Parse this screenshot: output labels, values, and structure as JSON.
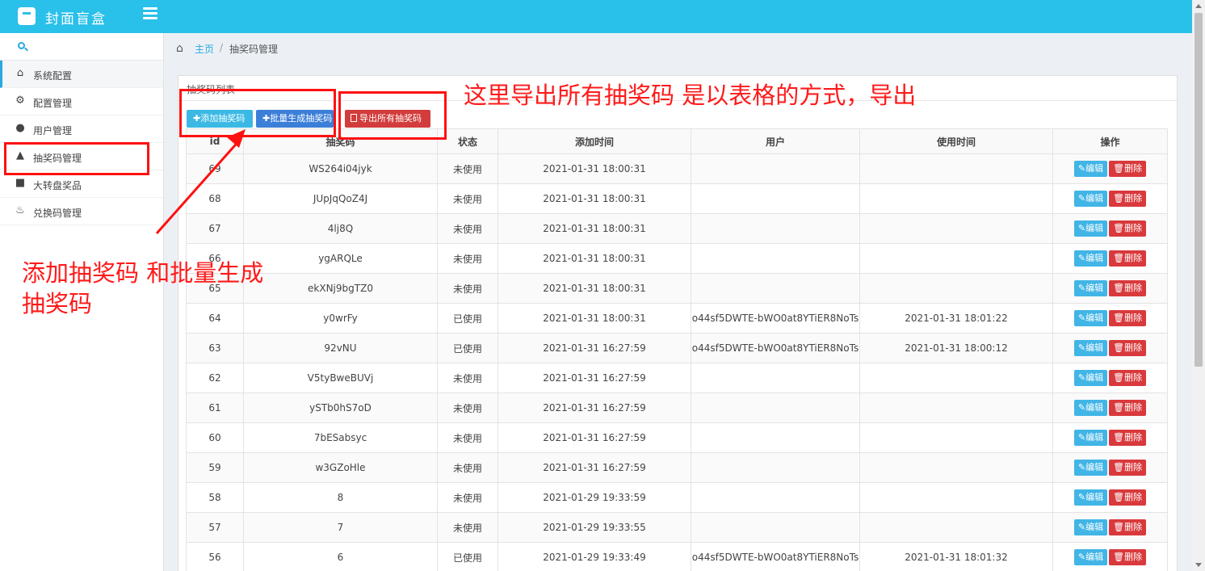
{
  "app": {
    "title": "封面盲盒"
  },
  "sidebar": {
    "items": [
      {
        "label": "系统配置",
        "icon": "home-icon"
      },
      {
        "label": "配置管理",
        "icon": "gear-icon"
      },
      {
        "label": "用户管理",
        "icon": "user-icon"
      },
      {
        "label": "抽奖码管理",
        "icon": "road-icon"
      },
      {
        "label": "大转盘奖品",
        "icon": "gift-icon"
      },
      {
        "label": "兑换码管理",
        "icon": "fire-icon"
      }
    ]
  },
  "breadcrumb": {
    "home": "主页",
    "separator": "/",
    "current": "抽奖码管理"
  },
  "panel": {
    "title": "抽奖码列表"
  },
  "toolbar": {
    "add_label": "✚添加抽奖码",
    "batch_label": "✚批量生成抽奖码",
    "export_label": "导出所有抽奖码"
  },
  "table": {
    "headers": [
      "id",
      "抽奖码",
      "状态",
      "添加时间",
      "用户",
      "使用时间",
      "操作"
    ],
    "edit_label": "编辑",
    "delete_label": "删除",
    "rows": [
      {
        "id": "69",
        "code": "WS264i04jyk",
        "status": "未使用",
        "added": "2021-01-31 18:00:31",
        "user": "",
        "used": ""
      },
      {
        "id": "68",
        "code": "JUpJqQoZ4J",
        "status": "未使用",
        "added": "2021-01-31 18:00:31",
        "user": "",
        "used": ""
      },
      {
        "id": "67",
        "code": "4lj8Q",
        "status": "未使用",
        "added": "2021-01-31 18:00:31",
        "user": "",
        "used": ""
      },
      {
        "id": "66",
        "code": "ygARQLe",
        "status": "未使用",
        "added": "2021-01-31 18:00:31",
        "user": "",
        "used": ""
      },
      {
        "id": "65",
        "code": "ekXNj9bgTZ0",
        "status": "未使用",
        "added": "2021-01-31 18:00:31",
        "user": "",
        "used": ""
      },
      {
        "id": "64",
        "code": "y0wrFy",
        "status": "已使用",
        "added": "2021-01-31 18:00:31",
        "user": "o44sf5DWTE-bWO0at8YTiER8NoTs",
        "used": "2021-01-31 18:01:22"
      },
      {
        "id": "63",
        "code": "92vNU",
        "status": "已使用",
        "added": "2021-01-31 16:27:59",
        "user": "o44sf5DWTE-bWO0at8YTiER8NoTs",
        "used": "2021-01-31 18:00:12"
      },
      {
        "id": "62",
        "code": "V5tyBweBUVj",
        "status": "未使用",
        "added": "2021-01-31 16:27:59",
        "user": "",
        "used": ""
      },
      {
        "id": "61",
        "code": "ySTb0hS7oD",
        "status": "未使用",
        "added": "2021-01-31 16:27:59",
        "user": "",
        "used": ""
      },
      {
        "id": "60",
        "code": "7bESabsyc",
        "status": "未使用",
        "added": "2021-01-31 16:27:59",
        "user": "",
        "used": ""
      },
      {
        "id": "59",
        "code": "w3GZoHle",
        "status": "未使用",
        "added": "2021-01-31 16:27:59",
        "user": "",
        "used": ""
      },
      {
        "id": "58",
        "code": "8",
        "status": "未使用",
        "added": "2021-01-29 19:33:59",
        "user": "",
        "used": ""
      },
      {
        "id": "57",
        "code": "7",
        "status": "未使用",
        "added": "2021-01-29 19:33:55",
        "user": "",
        "used": ""
      },
      {
        "id": "56",
        "code": "6",
        "status": "已使用",
        "added": "2021-01-29 19:33:49",
        "user": "o44sf5DWTE-bWO0at8YTiER8NoTs",
        "used": "2021-01-31 18:01:32"
      }
    ]
  },
  "annotations": {
    "export_note": "这里导出所有抽奖码 是以表格的方式，导出",
    "add_note_line1": "添加抽奖码 和批量生成",
    "add_note_line2": "抽奖码"
  },
  "colors": {
    "topbar": "#29c0e9",
    "accent": "#29a9e0",
    "danger": "#d23c3c",
    "annotation": "#ff1a1a"
  }
}
